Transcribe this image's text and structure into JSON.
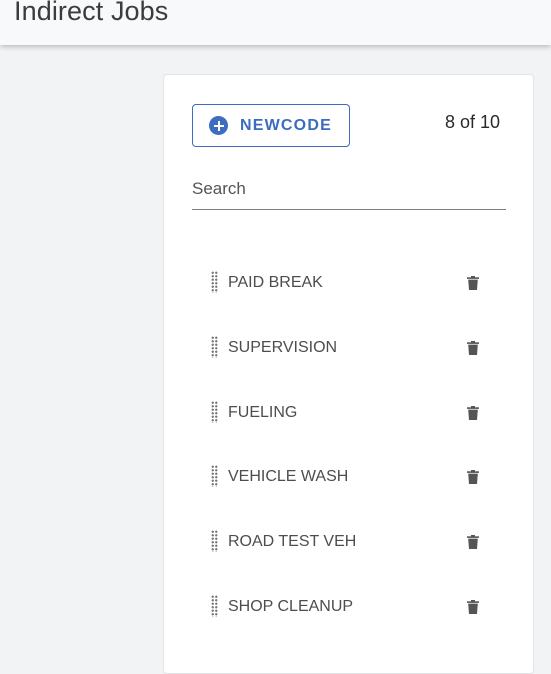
{
  "header": {
    "title": "Indirect Jobs"
  },
  "toolbar": {
    "new_button_label": "NEWCODE",
    "new_button_icon": "add-circle-icon",
    "count_label": "8 of 10"
  },
  "search": {
    "placeholder": "Search",
    "value": ""
  },
  "items": [
    {
      "label": "PAID BREAK"
    },
    {
      "label": "SUPERVISION"
    },
    {
      "label": "FUELING"
    },
    {
      "label": "VEHICLE WASH"
    },
    {
      "label": "ROAD TEST VEH"
    },
    {
      "label": "SHOP CLEANUP"
    }
  ],
  "icons": {
    "drag": "drag-handle-icon",
    "delete": "trash-icon"
  },
  "colors": {
    "accent": "#3b6cc0",
    "background": "#f1f3f5",
    "card": "#ffffff"
  }
}
